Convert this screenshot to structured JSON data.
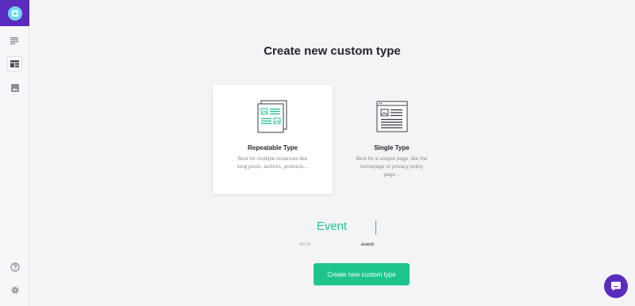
{
  "sidebar": {
    "logo_icon": "app-logo-icon",
    "items": [
      {
        "name": "list-icon",
        "active": false
      },
      {
        "name": "custom-types-icon",
        "active": true
      },
      {
        "name": "media-image-icon",
        "active": false
      }
    ],
    "help_icon": "help-circle-icon",
    "settings_icon": "gear-icon"
  },
  "colors": {
    "brand": "#5b2bbf",
    "accent": "#1dc58a",
    "text": "#24242c"
  },
  "main": {
    "title": "Create new custom type",
    "cards": [
      {
        "title": "Repeatable Type",
        "description": "Best for multiple instances like blog posts, authors, products...",
        "selected": true
      },
      {
        "title": "Single Type",
        "description": "Best for a unique page, like the homepage or privacy policy page...",
        "selected": false
      }
    ],
    "name_input": {
      "value": "Event"
    },
    "api_id": {
      "label": "API ID",
      "value": "event"
    },
    "create_button": "Create new custom type"
  },
  "chat": {
    "icon": "chat-bubble-icon"
  }
}
